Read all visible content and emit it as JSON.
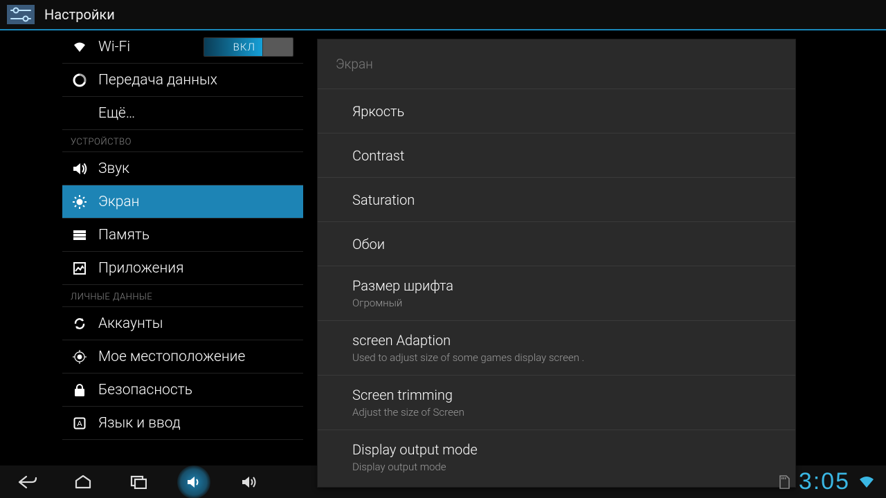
{
  "header": {
    "title": "Настройки"
  },
  "sidebar": [
    {
      "type": "item",
      "id": "wifi",
      "icon": "wifi-icon",
      "label": "Wi-Fi",
      "toggle": {
        "on": true,
        "text": "ВКЛ"
      }
    },
    {
      "type": "item",
      "id": "data",
      "icon": "data-usage-icon",
      "label": "Передача данных"
    },
    {
      "type": "item",
      "id": "more",
      "icon": "",
      "label": "Ещё…"
    },
    {
      "type": "header",
      "label": "УСТРОЙСТВО"
    },
    {
      "type": "item",
      "id": "sound",
      "icon": "sound-icon",
      "label": "Звук"
    },
    {
      "type": "item",
      "id": "display",
      "icon": "display-icon",
      "label": "Экран",
      "selected": true
    },
    {
      "type": "item",
      "id": "storage",
      "icon": "storage-icon",
      "label": "Память"
    },
    {
      "type": "item",
      "id": "apps",
      "icon": "apps-icon",
      "label": "Приложения"
    },
    {
      "type": "header",
      "label": "ЛИЧНЫЕ ДАННЫЕ"
    },
    {
      "type": "item",
      "id": "accounts",
      "icon": "sync-icon",
      "label": "Аккаунты"
    },
    {
      "type": "item",
      "id": "location",
      "icon": "location-icon",
      "label": "Мое местоположение"
    },
    {
      "type": "item",
      "id": "security",
      "icon": "lock-icon",
      "label": "Безопасность"
    },
    {
      "type": "item",
      "id": "language",
      "icon": "language-icon",
      "label": "Язык и ввод"
    }
  ],
  "detail": {
    "header": "Экран",
    "items": [
      {
        "title": "Яркость"
      },
      {
        "title": "Contrast"
      },
      {
        "title": "Saturation"
      },
      {
        "title": "Обои"
      },
      {
        "title": "Размер шрифта",
        "sub": "Огромный"
      },
      {
        "title": "screen Adaption",
        "sub": "Used to adjust size of some games display screen ."
      },
      {
        "title": "Screen trimming",
        "sub": "Adjust the size of Screen"
      },
      {
        "title": "Display output mode",
        "sub": "Display output mode"
      }
    ]
  },
  "navbar": {
    "clock": "3:05"
  }
}
